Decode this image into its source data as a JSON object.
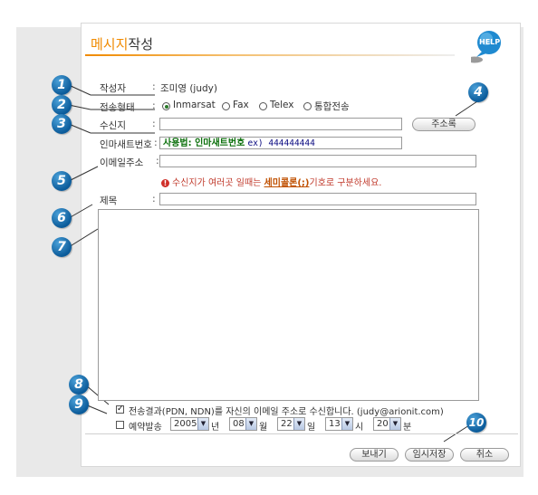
{
  "header": {
    "title_accent": "메시지",
    "title_rest": "작성",
    "help_label": "HELP"
  },
  "form": {
    "author_label": "작성자",
    "author_value": "조미영 (judy)",
    "send_type_label": "전송형태",
    "send_types": [
      "Inmarsat",
      "Fax",
      "Telex",
      "통합전송"
    ],
    "send_type_selected": "Inmarsat",
    "recipient_label": "수신지",
    "recipient_value": "",
    "address_book_label": "주소록",
    "inmarsat_label": "인마새트번호",
    "inmarsat_hint_key": "사용법: 인마새트번호",
    "inmarsat_hint_val": "ex) 444444444",
    "email_label": "이메일주소",
    "email_value": "",
    "notice_pre": "수신지가 여러곳 일때는 ",
    "notice_link": "세미콜론(;)",
    "notice_post": "기호로 구분하세요.",
    "subject_label": "제목",
    "subject_value": "",
    "body_value": "",
    "colon": ":"
  },
  "options": {
    "receive_result_checked": true,
    "receive_result_label": "전송결과(PDN, NDN)를 자신의 이메일 주소로 수신합니다. (judy@arionit.com)",
    "schedule_checked": false,
    "schedule_label": "예약발송",
    "year": "2005",
    "year_unit": "년",
    "month": "08",
    "month_unit": "월",
    "day": "22",
    "day_unit": "일",
    "hour": "13",
    "hour_unit": "시",
    "minute": "20",
    "minute_unit": "분"
  },
  "actions": {
    "send_label": "보내기",
    "save_draft_label": "임시저장",
    "cancel_label": "취소"
  },
  "callouts": [
    "1",
    "2",
    "3",
    "4",
    "5",
    "6",
    "7",
    "8",
    "9",
    "10"
  ],
  "colors": {
    "accent": "#f08a00",
    "callout": "#0b5b9a",
    "notice": "#c0392b"
  }
}
